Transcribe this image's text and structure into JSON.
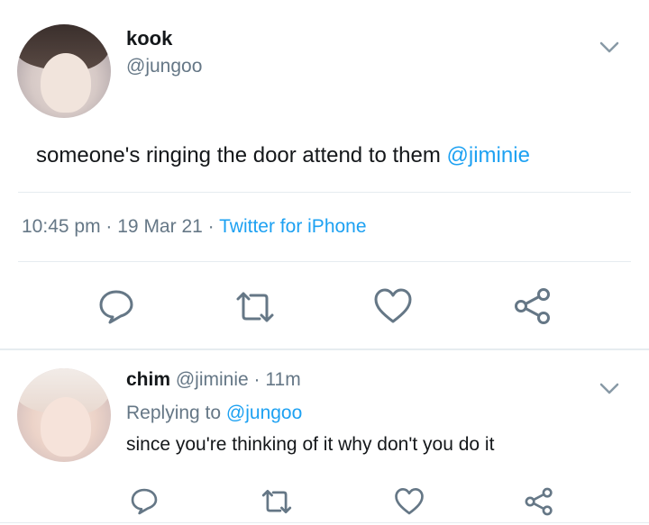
{
  "tweet": {
    "display_name": "kook",
    "handle": "@jungoo",
    "text_prefix": "someone's ringing the door attend to them ",
    "text_mention": "@jiminie",
    "time": "10:45 pm",
    "sep1": "·",
    "date": "19 Mar 21",
    "sep2": "·",
    "source": "Twitter for iPhone"
  },
  "reply": {
    "display_name": "chim",
    "handle": "@jiminie",
    "sep": "·",
    "age": "11m",
    "replying_label": "Replying to ",
    "replying_handle": "@jungoo",
    "text": "since you're thinking of it why don't you do it"
  },
  "icons": {
    "reply": "reply-icon",
    "retweet": "retweet-icon",
    "like": "heart-icon",
    "share": "share-icon",
    "menu": "chevron-down-icon"
  },
  "colors": {
    "accent": "#1da1f2",
    "icon": "#657786",
    "text": "#14171a",
    "divider": "#e6ecf0"
  }
}
